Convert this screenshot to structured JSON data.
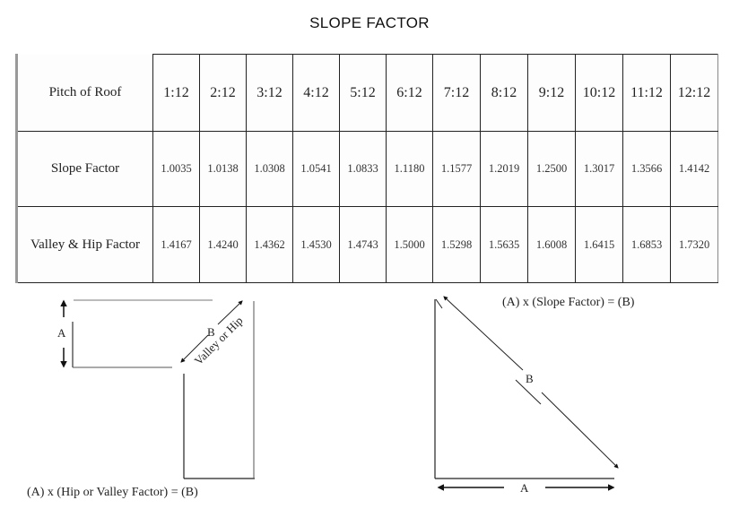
{
  "title": "SLOPE FACTOR",
  "table": {
    "row_headers": [
      "Pitch of Roof",
      "Slope Factor",
      "Valley & Hip Factor"
    ],
    "pitch": [
      "1:12",
      "2:12",
      "3:12",
      "4:12",
      "5:12",
      "6:12",
      "7:12",
      "8:12",
      "9:12",
      "10:12",
      "11:12",
      "12:12"
    ],
    "slope_factor": [
      "1.0035",
      "1.0138",
      "1.0308",
      "1.0541",
      "1.0833",
      "1.1180",
      "1.1577",
      "1.2019",
      "1.2500",
      "1.3017",
      "1.3566",
      "1.4142"
    ],
    "valley_hip_factor": [
      "1.4167",
      "1.4240",
      "1.4362",
      "1.4530",
      "1.4743",
      "1.5000",
      "1.5298",
      "1.5635",
      "1.6008",
      "1.6415",
      "1.6853",
      "1.7320"
    ]
  },
  "left_diagram": {
    "label_a": "A",
    "label_b": "B",
    "diagonal_label": "Valley or Hip",
    "caption": "(A) x (Hip or Valley Factor) = (B)"
  },
  "right_diagram": {
    "label_a": "A",
    "label_b": "B",
    "caption": "(A) x (Slope Factor) = (B)"
  }
}
